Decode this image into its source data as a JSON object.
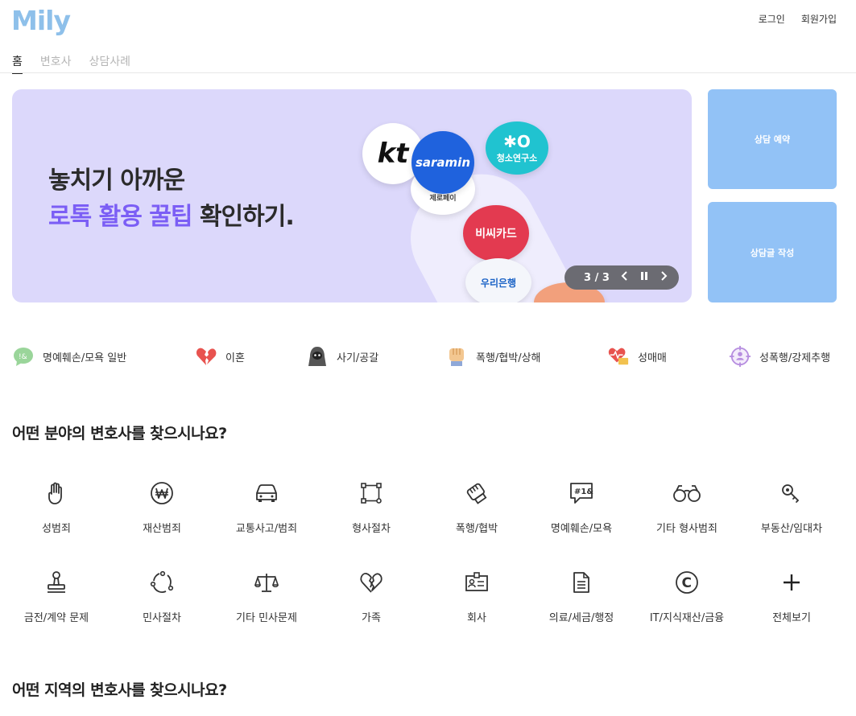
{
  "header": {
    "logo": "Mily",
    "login": "로그인",
    "signup": "회원가입"
  },
  "tabs": [
    {
      "label": "홈"
    },
    {
      "label": "변호사"
    },
    {
      "label": "상담사례"
    }
  ],
  "banner": {
    "line1": "놓치기 아까운",
    "line2_highlight": "로톡 활용 꿀팁",
    "line2_rest": " 확인하기.",
    "coins": {
      "kt": "kt",
      "saramin": "saramin",
      "youth": "청소연구소",
      "zero": "zero",
      "zero_sub": "제로페이",
      "bc": "비씨카드",
      "woori": "우리은행"
    },
    "pager": "3 / 3",
    "prev_icon": "chevron-left",
    "pause_icon": "pause",
    "next_icon": "chevron-right"
  },
  "side_buttons": {
    "reserve": "상담 예약",
    "write": "상담글 작성"
  },
  "quick_links": [
    {
      "label": "명예훼손/모욕 일반",
      "icon": "speech-bubble-icon",
      "color": "#8fd18f"
    },
    {
      "label": "이혼",
      "icon": "broken-heart-icon",
      "color": "#e8534f"
    },
    {
      "label": "사기/공갈",
      "icon": "hooded-thief-icon",
      "color": "#555555"
    },
    {
      "label": "폭행/협박/상해",
      "icon": "fist-icon",
      "color": "#f2c48d"
    },
    {
      "label": "성매매",
      "icon": "heart-money-icon",
      "color": "#e8534f"
    },
    {
      "label": "성폭행/강제추행",
      "icon": "target-person-icon",
      "color": "#b78ee0"
    }
  ],
  "field_section": {
    "title": "어떤 분야의 변호사를 찾으시나요?",
    "categories": [
      {
        "label": "성범죄",
        "icon": "hand-stop-icon"
      },
      {
        "label": "재산범죄",
        "icon": "won-coin-icon"
      },
      {
        "label": "교통사고/범죄",
        "icon": "car-icon"
      },
      {
        "label": "형사절차",
        "icon": "flow-nodes-icon"
      },
      {
        "label": "폭행/협박",
        "icon": "fist-icon"
      },
      {
        "label": "명예훼손/모욕",
        "icon": "symbols-bubble-icon"
      },
      {
        "label": "기타 형사범죄",
        "icon": "binoculars-icon"
      },
      {
        "label": "부동산/임대차",
        "icon": "key-icon"
      },
      {
        "label": "금전/계약 문제",
        "icon": "stamp-icon"
      },
      {
        "label": "민사절차",
        "icon": "cycle-icon"
      },
      {
        "label": "기타 민사문제",
        "icon": "scales-icon"
      },
      {
        "label": "가족",
        "icon": "broken-heart-icon"
      },
      {
        "label": "회사",
        "icon": "id-badge-icon"
      },
      {
        "label": "의료/세금/행정",
        "icon": "document-icon"
      },
      {
        "label": "IT/지식재산/금융",
        "icon": "copyright-icon"
      },
      {
        "label": "전체보기",
        "icon": "plus-icon"
      }
    ]
  },
  "region_section": {
    "title": "어떤 지역의 변호사를 찾으시나요?"
  }
}
